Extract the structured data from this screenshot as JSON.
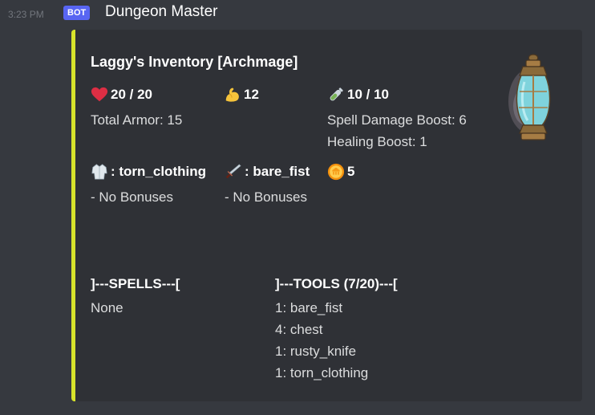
{
  "message": {
    "timestamp": "3:23 PM",
    "badge": "BOT",
    "author": "Dungeon Master"
  },
  "embed": {
    "accent_color": "#d7e32b",
    "title": "Laggy's Inventory [Archmage]",
    "health": {
      "icon": "heart-icon",
      "value": "20 / 20",
      "lines": [
        "Total Armor: 15"
      ]
    },
    "strength": {
      "icon": "flexed-bicep-icon",
      "value": "12"
    },
    "mana": {
      "icon": "potion-icon",
      "value": "10 / 10",
      "lines": [
        "Spell Damage Boost: 6",
        "Healing Boost: 1"
      ]
    },
    "armor": {
      "icon": "coat-icon",
      "value": ": torn_clothing",
      "lines": [
        "- No Bonuses"
      ]
    },
    "weapon": {
      "icon": "dagger-icon",
      "value": ": bare_fist",
      "lines": [
        "- No Bonuses"
      ]
    },
    "gold": {
      "icon": "coin-icon",
      "value": "5"
    },
    "spells": {
      "title": "]---SPELLS---[",
      "items": [
        "None"
      ]
    },
    "tools": {
      "title": "]---TOOLS (7/20)---[",
      "items": [
        "1: bare_fist",
        "4: chest",
        "1: rusty_knife",
        "1: torn_clothing"
      ]
    },
    "thumbnail": "lantern-image"
  }
}
